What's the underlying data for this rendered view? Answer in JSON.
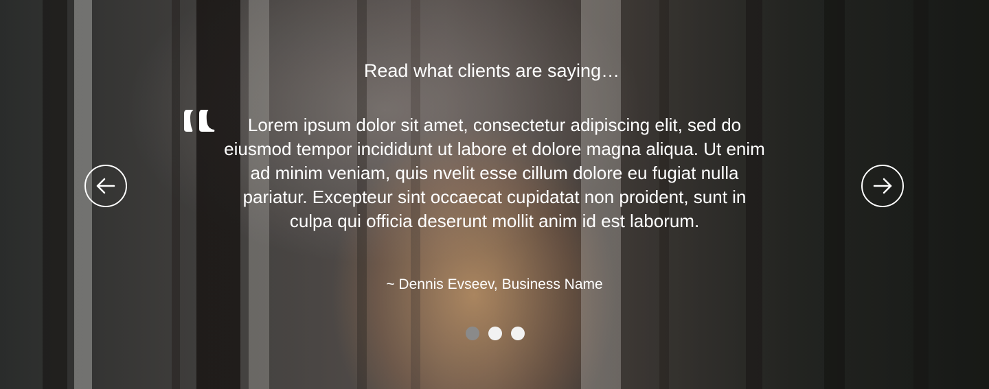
{
  "testimonials": {
    "heading": "Read what clients are saying…",
    "quote": "Lorem ipsum dolor sit amet, consectetur adipiscing elit, sed do eiusmod tempor incididunt ut labore et dolore magna aliqua. Ut enim ad minim veniam, quis nvelit esse cillum dolore eu fugiat nulla pariatur. Excepteur sint occaecat cupidatat non proident, sunt in culpa qui officia deserunt mollit anim id est laborum.",
    "author": "~ Dennis Evseev, Business Name",
    "quote_icon": "quote-mark-icon",
    "prev_icon": "arrow-left-icon",
    "next_icon": "arrow-right-icon",
    "slides_total": 3,
    "active_slide": 1
  },
  "colors": {
    "text": "#ffffff",
    "dot_inactive": "#f2f2f2",
    "dot_active": "#8a8a8a"
  }
}
